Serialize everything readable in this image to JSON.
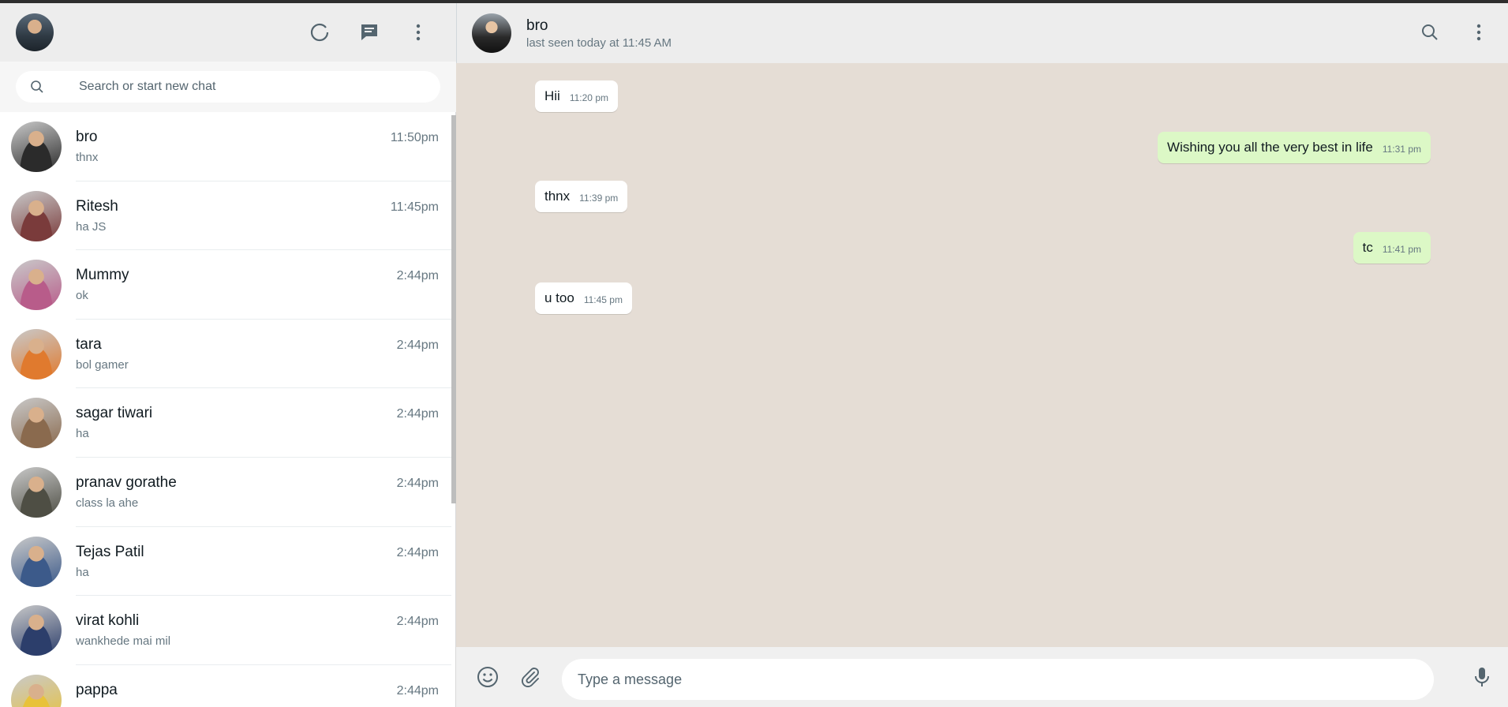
{
  "sidebar": {
    "search": {
      "placeholder": "Search or start new chat"
    },
    "chats": [
      {
        "name": "bro",
        "preview": "thnx",
        "time": "11:50pm",
        "avatar_color": "#2b2b2b"
      },
      {
        "name": "Ritesh",
        "preview": "ha JS",
        "time": "11:45pm",
        "avatar_color": "#7a3b3b"
      },
      {
        "name": "Mummy",
        "preview": "ok",
        "time": "2:44pm",
        "avatar_color": "#b85c8a"
      },
      {
        "name": "tara",
        "preview": "bol gamer",
        "time": "2:44pm",
        "avatar_color": "#e07a2e"
      },
      {
        "name": "sagar tiwari",
        "preview": "ha",
        "time": "2:44pm",
        "avatar_color": "#8a6a4e"
      },
      {
        "name": "pranav gorathe",
        "preview": "class la ahe",
        "time": "2:44pm",
        "avatar_color": "#4e4e44"
      },
      {
        "name": "Tejas Patil",
        "preview": "ha",
        "time": "2:44pm",
        "avatar_color": "#3c5a8a"
      },
      {
        "name": "virat kohli",
        "preview": "wankhede mai mil",
        "time": "2:44pm",
        "avatar_color": "#2c3e6b"
      },
      {
        "name": "pappa",
        "preview": "",
        "time": "2:44pm",
        "avatar_color": "#e8c23a"
      }
    ]
  },
  "conversation": {
    "contact_name": "bro",
    "contact_status": "last seen today at 11:45 AM",
    "messages": [
      {
        "text": "Hii",
        "time": "11:20 pm",
        "direction": "in"
      },
      {
        "text": "Wishing you all the very best in life",
        "time": "11:31 pm",
        "direction": "out"
      },
      {
        "text": "thnx",
        "time": "11:39 pm",
        "direction": "in"
      },
      {
        "text": "tc",
        "time": "11:41 pm",
        "direction": "out"
      },
      {
        "text": "u too",
        "time": "11:45 pm",
        "direction": "in"
      }
    ]
  },
  "composer": {
    "placeholder": "Type a message"
  },
  "colors": {
    "header_bg": "#ededed",
    "chat_bg": "#e5ddd5",
    "outgoing_bubble": "#dcf8c6",
    "incoming_bubble": "#ffffff",
    "icon_gray": "#54656f"
  },
  "icons": {
    "status": "status-icon",
    "new_chat": "new-chat-icon",
    "menu": "menu-dots-icon",
    "search": "search-icon",
    "emoji": "emoji-icon",
    "attach": "paperclip-icon",
    "mic": "microphone-icon"
  }
}
